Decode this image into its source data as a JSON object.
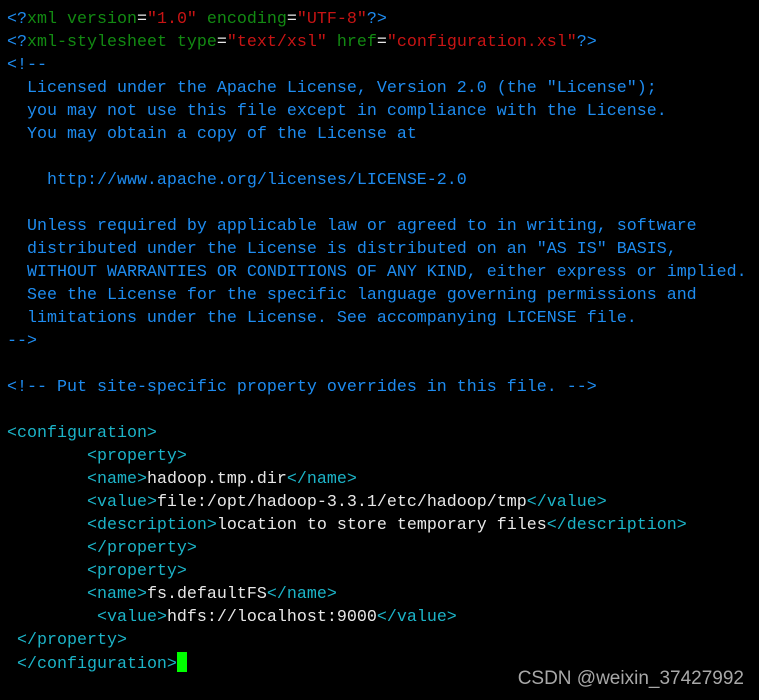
{
  "colors": {
    "blue": "#1e8cf0",
    "green": "#128a12",
    "red": "#c81414",
    "cyan": "#1cb4c8",
    "text": "#e8e8e8",
    "cursor": "#00ff00",
    "background": "#000000"
  },
  "lines": [
    [
      [
        "b",
        "<?"
      ],
      [
        "g",
        "xml version"
      ],
      [
        "w",
        "="
      ],
      [
        "r",
        "\"1.0\""
      ],
      [
        "g",
        " encoding"
      ],
      [
        "w",
        "="
      ],
      [
        "r",
        "\"UTF-8\""
      ],
      [
        "b",
        "?>"
      ]
    ],
    [
      [
        "b",
        "<?"
      ],
      [
        "g",
        "xml-stylesheet type"
      ],
      [
        "w",
        "="
      ],
      [
        "r",
        "\"text/xsl\""
      ],
      [
        "g",
        " href"
      ],
      [
        "w",
        "="
      ],
      [
        "r",
        "\"configuration.xsl\""
      ],
      [
        "b",
        "?>"
      ]
    ],
    [
      [
        "b",
        "<!--"
      ]
    ],
    [
      [
        "b",
        "  Licensed under the Apache License, Version 2.0 (the \"License\");"
      ]
    ],
    [
      [
        "b",
        "  you may not use this file except in compliance with the License."
      ]
    ],
    [
      [
        "b",
        "  You may obtain a copy of the License at"
      ]
    ],
    [],
    [
      [
        "b",
        "    http://www.apache.org/licenses/LICENSE-2.0"
      ]
    ],
    [],
    [
      [
        "b",
        "  Unless required by applicable law or agreed to in writing, software"
      ]
    ],
    [
      [
        "b",
        "  distributed under the License is distributed on an \"AS IS\" BASIS,"
      ]
    ],
    [
      [
        "b",
        "  WITHOUT WARRANTIES OR CONDITIONS OF ANY KIND, either express or implied."
      ]
    ],
    [
      [
        "b",
        "  See the License for the specific language governing permissions and"
      ]
    ],
    [
      [
        "b",
        "  limitations under the License. See accompanying LICENSE file."
      ]
    ],
    [
      [
        "b",
        "-->"
      ]
    ],
    [],
    [
      [
        "b",
        "<!-- Put site-specific property overrides in this file. -->"
      ]
    ],
    [],
    [
      [
        "c",
        "<configuration>"
      ]
    ],
    [
      [
        "t",
        "        "
      ],
      [
        "c",
        "<property>"
      ]
    ],
    [
      [
        "t",
        "        "
      ],
      [
        "c",
        "<name>"
      ],
      [
        "t",
        "hadoop.tmp.dir"
      ],
      [
        "c",
        "</name>"
      ]
    ],
    [
      [
        "t",
        "        "
      ],
      [
        "c",
        "<value>"
      ],
      [
        "t",
        "file:/opt/hadoop-3.3.1/etc/hadoop/tmp"
      ],
      [
        "c",
        "</value>"
      ]
    ],
    [
      [
        "t",
        "        "
      ],
      [
        "c",
        "<description>"
      ],
      [
        "t",
        "location to store temporary files"
      ],
      [
        "c",
        "</description>"
      ]
    ],
    [
      [
        "t",
        "        "
      ],
      [
        "c",
        "</property>"
      ]
    ],
    [
      [
        "t",
        "        "
      ],
      [
        "c",
        "<property>"
      ]
    ],
    [
      [
        "t",
        "        "
      ],
      [
        "c",
        "<name>"
      ],
      [
        "t",
        "fs.defaultFS"
      ],
      [
        "c",
        "</name>"
      ]
    ],
    [
      [
        "t",
        "         "
      ],
      [
        "c",
        "<value>"
      ],
      [
        "t",
        "hdfs://localhost:9000"
      ],
      [
        "c",
        "</value>"
      ]
    ],
    [
      [
        "t",
        " "
      ],
      [
        "c",
        "</property>"
      ]
    ],
    [
      [
        "t",
        " "
      ],
      [
        "c",
        "</configuration>"
      ]
    ]
  ],
  "watermark": "CSDN @weixin_37427992"
}
